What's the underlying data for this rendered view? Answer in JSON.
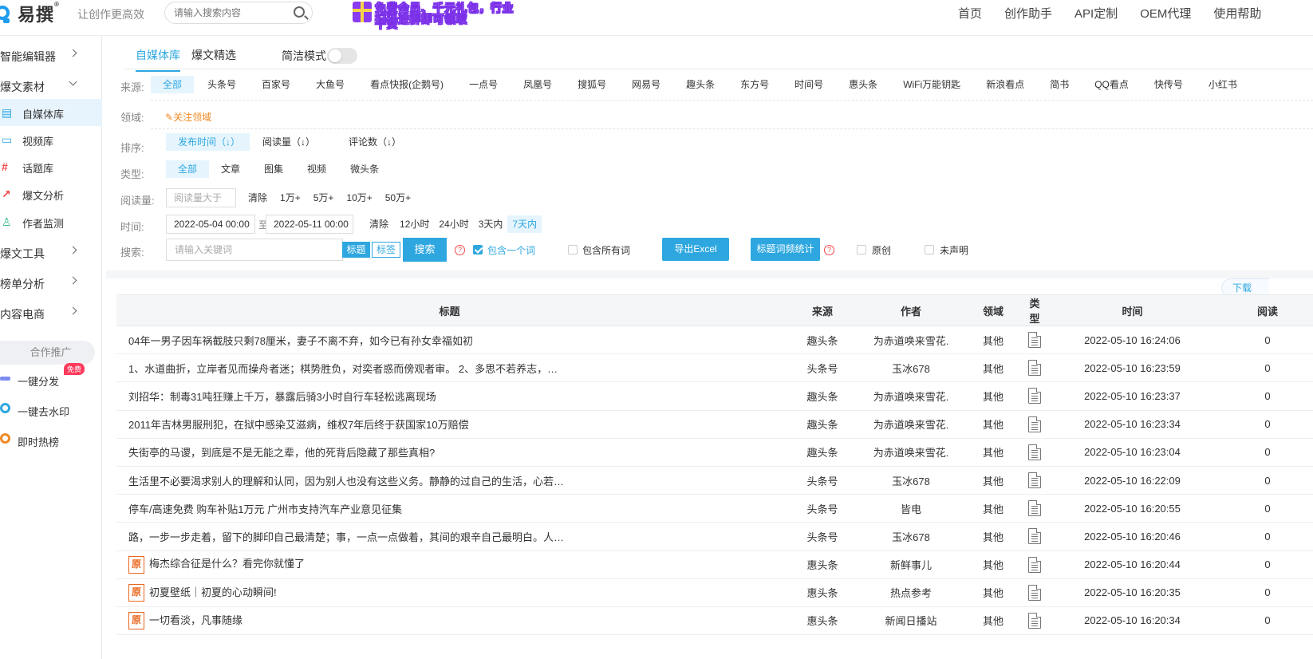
{
  "header": {
    "logo_text": "易撰",
    "logo_reg": "®",
    "slogan": "让创作更高效",
    "search_placeholder": "请输入搜索内容",
    "banner_line1": "免费会员、千元礼包，行业干货",
    "banner_line2": "扫码进群即可领取",
    "nav": [
      "首页",
      "创作助手",
      "API定制",
      "OEM代理",
      "使用帮助"
    ]
  },
  "sidebar": {
    "groups": [
      {
        "label": "智能编辑器"
      },
      {
        "label": "爆文素材"
      },
      {
        "label": "爆文工具"
      },
      {
        "label": "榜单分析"
      },
      {
        "label": "内容电商"
      }
    ],
    "items": [
      {
        "label": "自媒体库",
        "icon": "doc-icon"
      },
      {
        "label": "视频库",
        "icon": "video-icon"
      },
      {
        "label": "话题库",
        "icon": "hash-icon"
      },
      {
        "label": "爆文分析",
        "icon": "chart-icon"
      },
      {
        "label": "作者监测",
        "icon": "user-add-icon"
      }
    ],
    "promo_label": "合作推广",
    "tools": [
      {
        "label": "一键分发",
        "badge": "免费"
      },
      {
        "label": "一键去水印"
      },
      {
        "label": "即时热榜"
      }
    ]
  },
  "tabs": [
    {
      "label": "自媒体库",
      "active": true
    },
    {
      "label": "爆文精选",
      "active": false
    }
  ],
  "simple_mode_label": "简洁模式",
  "filters": {
    "source_label": "来源:",
    "sources": [
      "全部",
      "头条号",
      "百家号",
      "大鱼号",
      "看点快报(企鹅号)",
      "一点号",
      "凤凰号",
      "搜狐号",
      "网易号",
      "趣头条",
      "东方号",
      "时间号",
      "惠头条",
      "WiFi万能钥匙",
      "新浪看点",
      "简书",
      "QQ看点",
      "快传号",
      "小红书"
    ],
    "domain_label": "领域:",
    "follow_label": "关注领域",
    "sort_label": "排序:",
    "sorts": [
      "发布时间（↓）",
      "阅读量（↓）",
      "评论数（↓）"
    ],
    "type_label": "类型:",
    "types": [
      "全部",
      "文章",
      "图集",
      "视频",
      "微头条"
    ],
    "read_label": "阅读量:",
    "read_placeholder": "阅读量大于",
    "reads": [
      "清除",
      "1万+",
      "5万+",
      "10万+",
      "50万+"
    ],
    "time_label": "时间:",
    "date_from": "2022-05-04 00:00",
    "date_sep": "至",
    "date_to": "2022-05-11 00:00",
    "times": [
      "清除",
      "12小时",
      "24小时",
      "3天内",
      "7天内"
    ],
    "search_label": "搜索:",
    "keyword_placeholder": "请输入关键词",
    "seg_title": "标题",
    "seg_tag": "标签",
    "search_button": "搜索",
    "include_one": "包含一个词",
    "include_all": "包含所有词",
    "export_excel": "导出Excel",
    "title_freq": "标题词频统计",
    "original": "原创",
    "undeclared": "未声明",
    "help_mark": "?"
  },
  "download_label": "下载",
  "table": {
    "columns": [
      "标题",
      "来源",
      "作者",
      "领域",
      "类型",
      "时间",
      "阅读"
    ],
    "rows": [
      {
        "original": false,
        "title": "04年一男子因车祸截肢只剩78厘米，妻子不离不弃，如今已有孙女幸福如初",
        "source": "趣头条",
        "author": "为赤道唤来雪花.",
        "domain": "其他",
        "time": "2022-05-10 16:24:06",
        "reads": "0"
      },
      {
        "original": false,
        "title": "1、水道曲折，立岸者见而操舟者迷；棋势胜负，对奕者惑而傍观者审。 2、多思不若养志，…",
        "source": "头条号",
        "author": "玉冰678",
        "domain": "其他",
        "time": "2022-05-10 16:23:59",
        "reads": "0"
      },
      {
        "original": false,
        "title": "刘招华：制毒31吨狂赚上千万，暴露后骑3小时自行车轻松逃离现场",
        "source": "趣头条",
        "author": "为赤道唤来雪花.",
        "domain": "其他",
        "time": "2022-05-10 16:23:37",
        "reads": "0"
      },
      {
        "original": false,
        "title": "2011年吉林男服刑犯，在狱中感染艾滋病，维权7年后终于获国家10万赔偿",
        "source": "趣头条",
        "author": "为赤道唤来雪花.",
        "domain": "其他",
        "time": "2022-05-10 16:23:34",
        "reads": "0"
      },
      {
        "original": false,
        "title": "失街亭的马谡，到底是不是无能之辈，他的死背后隐藏了那些真相?",
        "source": "趣头条",
        "author": "为赤道唤来雪花.",
        "domain": "其他",
        "time": "2022-05-10 16:23:04",
        "reads": "0"
      },
      {
        "original": false,
        "title": "生活里不必要渴求别人的理解和认同，因为别人也没有这些义务。静静的过自己的生活，心若…",
        "source": "头条号",
        "author": "玉冰678",
        "domain": "其他",
        "time": "2022-05-10 16:22:09",
        "reads": "0"
      },
      {
        "original": false,
        "title": "停车/高速免费 购车补贴1万元 广州市支持汽车产业意见征集",
        "source": "头条号",
        "author": "皆电",
        "domain": "其他",
        "time": "2022-05-10 16:20:55",
        "reads": "0"
      },
      {
        "original": false,
        "title": "路，一步一步走着，留下的脚印自己最清楚；事，一点一点做着，其间的艰辛自己最明白。人…",
        "source": "头条号",
        "author": "玉冰678",
        "domain": "其他",
        "time": "2022-05-10 16:20:46",
        "reads": "0"
      },
      {
        "original": true,
        "title": "梅杰综合征是什么？看完你就懂了",
        "source": "惠头条",
        "author": "新鲜事儿",
        "domain": "其他",
        "time": "2022-05-10 16:20:44",
        "reads": "0"
      },
      {
        "original": true,
        "title": "初夏壁纸｜初夏的心动瞬间!",
        "source": "惠头条",
        "author": "热点参考",
        "domain": "其他",
        "time": "2022-05-10 16:20:35",
        "reads": "0"
      },
      {
        "original": true,
        "title": "一切看淡，凡事随缘",
        "source": "惠头条",
        "author": "新闻日播站",
        "domain": "其他",
        "time": "2022-05-10 16:20:34",
        "reads": "0"
      }
    ],
    "original_mark": "原"
  },
  "colors": {
    "accent": "#2ea7e0",
    "orange": "#e8651a",
    "red": "#f04848"
  }
}
